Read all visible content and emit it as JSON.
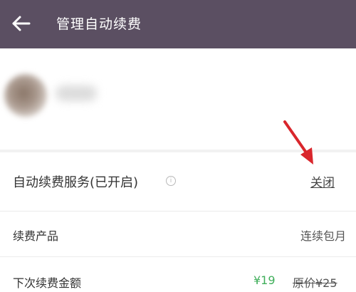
{
  "header": {
    "title": "管理自动续费",
    "back_icon": "arrow-left-icon",
    "background": "#5b4f62"
  },
  "renewal": {
    "label": "自动续费服务(已开启)",
    "info_icon": "info-icon",
    "info_glyph": "i",
    "close_label": "关闭"
  },
  "product": {
    "label": "续费产品",
    "value": "连续包月"
  },
  "amount": {
    "label": "下次续费金额",
    "price": "¥19",
    "original_price": "原价¥25",
    "price_color": "#3fae5a"
  },
  "annotation": {
    "arrow_color": "#d9262c"
  }
}
